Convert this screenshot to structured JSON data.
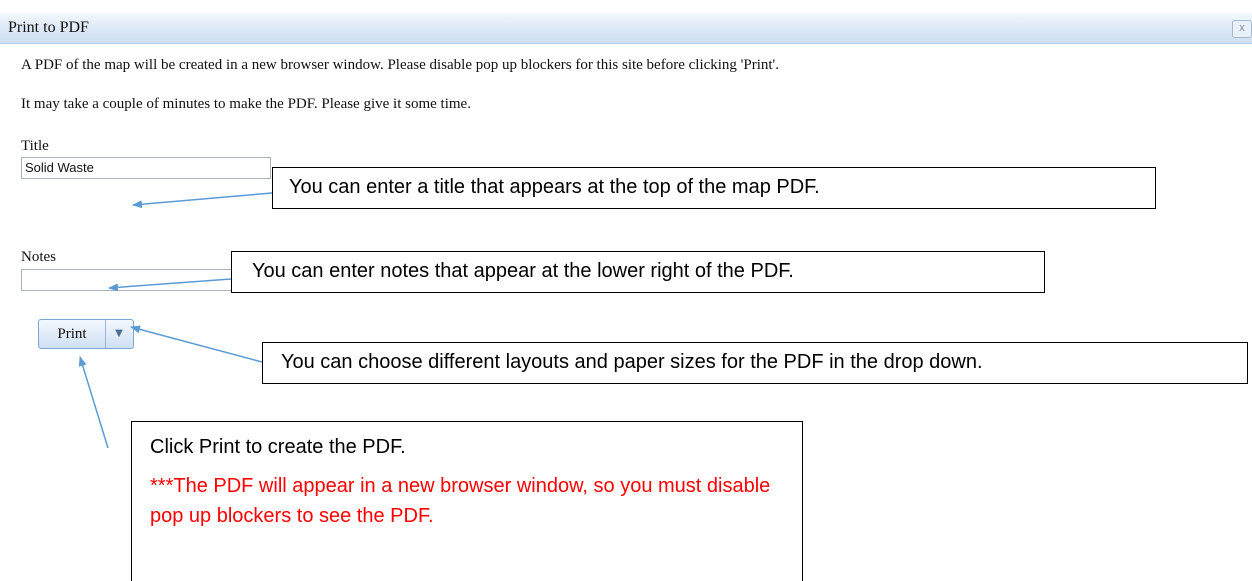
{
  "dialog": {
    "title": "Print to PDF",
    "close_label": "x",
    "intro": "A PDF of the map will be created in a new browser window. Please disable pop up blockers for this site before clicking 'Print'.",
    "note": "It may take a couple of minutes to make the PDF. Please give it some time.",
    "title_field": {
      "label": "Title",
      "value": "Solid Waste"
    },
    "notes_field": {
      "label": "Notes",
      "value": ""
    },
    "print_button": {
      "label": "Print",
      "dropdown_icon": "chevron-down-icon"
    }
  },
  "callouts": {
    "title": "You can enter a title that appears at the top of the map PDF.",
    "notes": "You can enter notes that appear at the lower right of the PDF.",
    "dropdown": "You can choose different layouts and paper sizes for the PDF in the drop down.",
    "print_line1": "Click Print to create the PDF.",
    "print_line2": "***The PDF will appear in a new browser window, so you must disable pop up blockers to see the PDF."
  },
  "colors": {
    "arrow": "#5b9bd5",
    "warning": "#ff0000",
    "titlebar": "#dbe8f6"
  }
}
